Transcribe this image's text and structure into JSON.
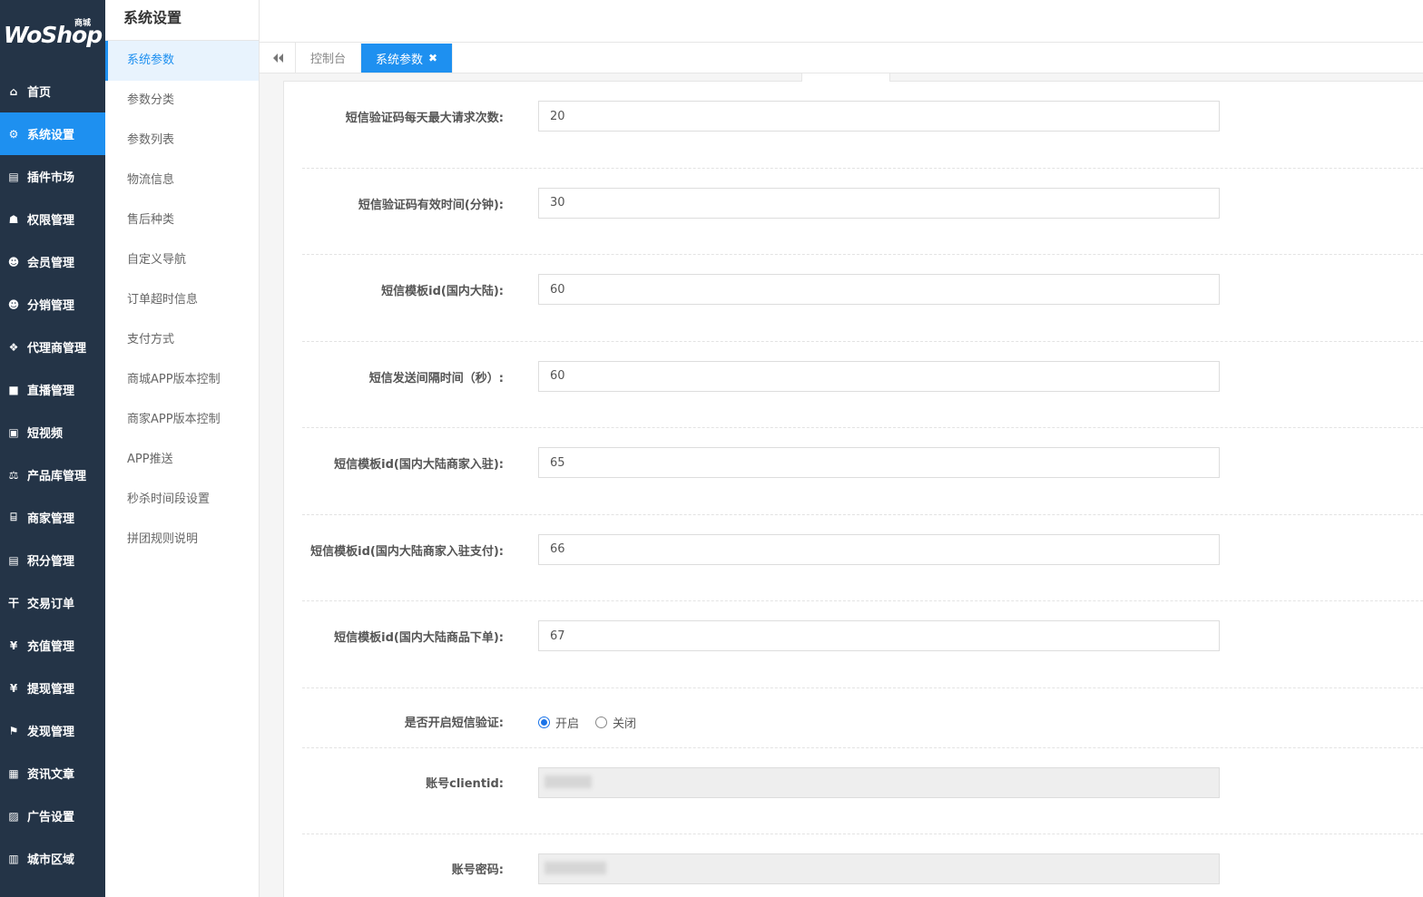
{
  "logo": {
    "text": "WoShop",
    "sub": "商城"
  },
  "sidebar": {
    "items": [
      {
        "label": "首页",
        "icon": "home-icon",
        "glyph": "⌂",
        "active": false
      },
      {
        "label": "系统设置",
        "icon": "gear-icon",
        "glyph": "⚙",
        "active": true
      },
      {
        "label": "插件市场",
        "icon": "plugin-icon",
        "glyph": "▤",
        "active": false
      },
      {
        "label": "权限管理",
        "icon": "sitemap-icon",
        "glyph": "☗",
        "active": false
      },
      {
        "label": "会员管理",
        "icon": "users-icon",
        "glyph": "☻",
        "active": false
      },
      {
        "label": "分销管理",
        "icon": "group-icon",
        "glyph": "☻",
        "active": false
      },
      {
        "label": "代理商管理",
        "icon": "cubes-icon",
        "glyph": "❖",
        "active": false
      },
      {
        "label": "直播管理",
        "icon": "video-icon",
        "glyph": "■",
        "active": false
      },
      {
        "label": "短视频",
        "icon": "file-video-icon",
        "glyph": "▣",
        "active": false
      },
      {
        "label": "产品库管理",
        "icon": "balance-scale-icon",
        "glyph": "⚖",
        "active": false
      },
      {
        "label": "商家管理",
        "icon": "bank-icon",
        "glyph": "⌸",
        "active": false
      },
      {
        "label": "积分管理",
        "icon": "file-points-icon",
        "glyph": "▤",
        "active": false
      },
      {
        "label": "交易订单",
        "icon": "order-icon",
        "glyph": "干",
        "active": false
      },
      {
        "label": "充值管理",
        "icon": "yen-icon",
        "glyph": "¥",
        "active": false
      },
      {
        "label": "提现管理",
        "icon": "yen-icon",
        "glyph": "¥",
        "active": false
      },
      {
        "label": "发现管理",
        "icon": "flag-icon",
        "glyph": "⚑",
        "active": false
      },
      {
        "label": "资讯文章",
        "icon": "newspaper-icon",
        "glyph": "▦",
        "active": false
      },
      {
        "label": "广告设置",
        "icon": "image-icon",
        "glyph": "▨",
        "active": false
      },
      {
        "label": "城市区域",
        "icon": "map-icon",
        "glyph": "▥",
        "active": false
      }
    ]
  },
  "subnav": {
    "title": "系统设置",
    "items": [
      {
        "label": "系统参数",
        "active": true
      },
      {
        "label": "参数分类",
        "active": false
      },
      {
        "label": "参数列表",
        "active": false
      },
      {
        "label": "物流信息",
        "active": false
      },
      {
        "label": "售后种类",
        "active": false
      },
      {
        "label": "自定义导航",
        "active": false
      },
      {
        "label": "订单超时信息",
        "active": false
      },
      {
        "label": "支付方式",
        "active": false
      },
      {
        "label": "商城APP版本控制",
        "active": false
      },
      {
        "label": "商家APP版本控制",
        "active": false
      },
      {
        "label": "APP推送",
        "active": false
      },
      {
        "label": "秒杀时间段设置",
        "active": false
      },
      {
        "label": "拼团规则说明",
        "active": false
      }
    ]
  },
  "tabs": {
    "toggle_icon": "double-chevron-left-icon",
    "items": [
      {
        "label": "控制台",
        "active": false
      },
      {
        "label": "系统参数",
        "active": true,
        "close": "✖"
      }
    ]
  },
  "form": {
    "fields": [
      {
        "label": "短信验证码每天最大请求次数:",
        "value": "20"
      },
      {
        "label": "短信验证码有效时间(分钟):",
        "value": "30"
      },
      {
        "label": "短信模板id(国内大陆):",
        "value": "60"
      },
      {
        "label": "短信发送间隔时间（秒）:",
        "value": "60"
      },
      {
        "label": "短信模板id(国内大陆商家入驻):",
        "value": "65"
      },
      {
        "label": "短信模板id(国内大陆商家入驻支付):",
        "value": "66"
      },
      {
        "label": "短信模板id(国内大陆商品下单):",
        "value": "67"
      }
    ],
    "sms_verify": {
      "label": "是否开启短信验证:",
      "options": [
        {
          "label": "开启",
          "checked": true
        },
        {
          "label": "关闭",
          "checked": false
        }
      ]
    },
    "client_id": {
      "label": "账号clientid:",
      "value": ""
    },
    "password": {
      "label": "账号密码:",
      "value": ""
    }
  },
  "colors": {
    "sidebar_bg": "#243447",
    "accent": "#1e90f0"
  }
}
